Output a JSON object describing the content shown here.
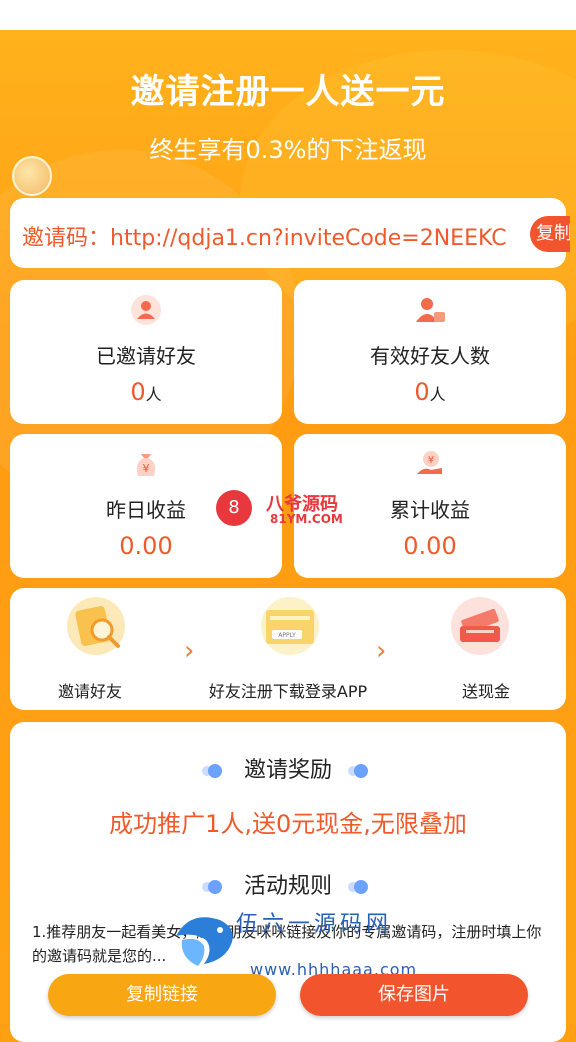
{
  "header": {
    "title": "邀请注册一人送一元",
    "subtitle": "终生享有0.3%的下注返现"
  },
  "invite": {
    "text": "邀请码：http://qdja1.cn?inviteCode=2NEEKC",
    "copy_label": "复制"
  },
  "stats": [
    {
      "label": "已邀请好友",
      "value": "0",
      "unit": "人",
      "icon": "friends-icon"
    },
    {
      "label": "有效好友人数",
      "value": "0",
      "unit": "人",
      "icon": "verified-user-icon"
    },
    {
      "label": "昨日收益",
      "value": "0.00",
      "unit": "",
      "icon": "money-bag-icon"
    },
    {
      "label": "累计收益",
      "value": "0.00",
      "unit": "",
      "icon": "money-hand-icon"
    }
  ],
  "steps": {
    "items": [
      {
        "label": "邀请好友",
        "icon": "invite-friends-icon"
      },
      {
        "label": "好友注册下载登录APP",
        "icon": "register-apply-icon"
      },
      {
        "label": "送现金",
        "icon": "cash-gift-icon"
      }
    ],
    "apply_text": "APPLY"
  },
  "rules": {
    "reward_title": "邀请奖励",
    "reward_text": "成功推广1人,送0元现金,无限叠加",
    "rules_title": "活动规则",
    "rule_text": "1.推荐朋友一起看美女，赶快朋友咪咪链接及你的专属邀请码，注册时填上你的邀请码就是您的..."
  },
  "buttons": {
    "copy_link": "复制链接",
    "save_image": "保存图片"
  },
  "watermarks": {
    "site1_badge": "8",
    "site1_name": "八爷源码",
    "site1_domain": "81YM.COM",
    "site2_name": "伍六一源码网",
    "site2_domain": "www.hhhhaaa.com"
  },
  "colors": {
    "primary_orange": "#ff9f12",
    "accent_red": "#f05a2b",
    "dot_blue": "#6da1ff"
  }
}
